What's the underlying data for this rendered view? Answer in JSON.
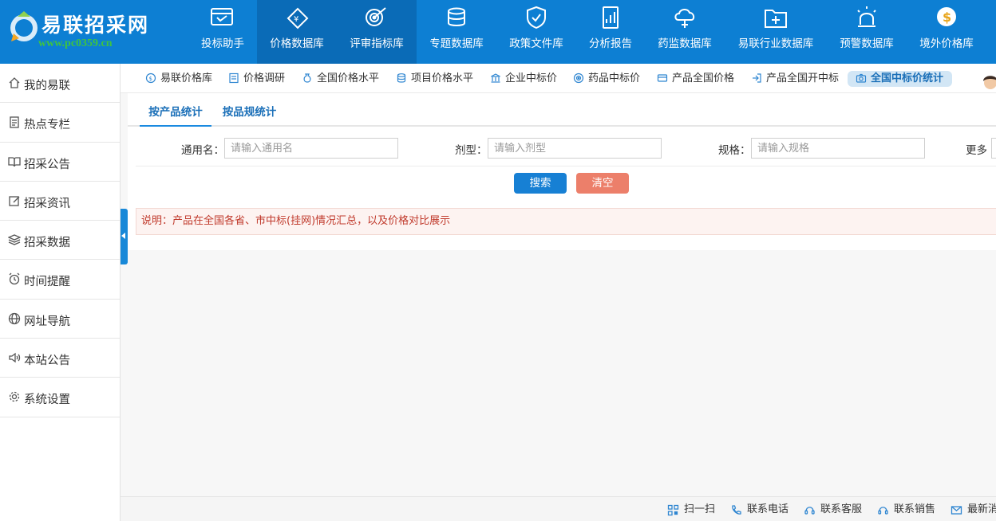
{
  "brand": {
    "name": "易联招采网",
    "url": "www.pc0359.cn"
  },
  "nav": [
    {
      "label": "投标助手",
      "icon": "bid-assistant-icon"
    },
    {
      "label": "价格数据库",
      "icon": "price-database-icon"
    },
    {
      "label": "评审指标库",
      "icon": "review-indicator-icon"
    },
    {
      "label": "专题数据库",
      "icon": "topic-database-icon"
    },
    {
      "label": "政策文件库",
      "icon": "policy-file-icon"
    },
    {
      "label": "分析报告",
      "icon": "analysis-report-icon"
    },
    {
      "label": "药监数据库",
      "icon": "drug-supervision-icon"
    },
    {
      "label": "易联行业数据库",
      "icon": "industry-database-icon"
    },
    {
      "label": "预警数据库",
      "icon": "warning-database-icon"
    },
    {
      "label": "境外价格库",
      "icon": "foreign-price-icon"
    }
  ],
  "sidebar": [
    {
      "label": "我的易联",
      "icon": "home-icon"
    },
    {
      "label": "热点专栏",
      "icon": "document-icon"
    },
    {
      "label": "招采公告",
      "icon": "book-icon"
    },
    {
      "label": "招采资讯",
      "icon": "edit-icon"
    },
    {
      "label": "招采数据",
      "icon": "layers-icon"
    },
    {
      "label": "时间提醒",
      "icon": "alarm-clock-icon"
    },
    {
      "label": "网址导航",
      "icon": "globe-icon"
    },
    {
      "label": "本站公告",
      "icon": "speaker-icon"
    },
    {
      "label": "系统设置",
      "icon": "gear-icon"
    }
  ],
  "subtabs": [
    {
      "label": "易联价格库",
      "icon": "coin-icon"
    },
    {
      "label": "价格调研",
      "icon": "report-icon"
    },
    {
      "label": "全国价格水平",
      "icon": "money-bag-icon"
    },
    {
      "label": "项目价格水平",
      "icon": "database-icon"
    },
    {
      "label": "企业中标价",
      "icon": "bank-icon"
    },
    {
      "label": "药品中标价",
      "icon": "target-icon"
    },
    {
      "label": "产品全国价格",
      "icon": "card-icon"
    },
    {
      "label": "产品全国开中标",
      "icon": "login-icon"
    },
    {
      "label": "全国中标价统计",
      "icon": "camera-icon"
    }
  ],
  "product_tabs": [
    "按产品统计",
    "按品规统计"
  ],
  "form": {
    "generic_name_label": "通用名：",
    "generic_name_placeholder": "请输入通用名",
    "dosage_label": "剂型：",
    "dosage_placeholder": "请输入剂型",
    "spec_label": "规格：",
    "spec_placeholder": "请输入规格",
    "more_label": "更多"
  },
  "buttons": {
    "search": "搜索",
    "clear": "清空"
  },
  "note": "说明：产品在全国各省、市中标(挂网)情况汇总，以及价格对比展示",
  "footer": [
    {
      "label": "扫一扫",
      "icon": "qr-code-icon"
    },
    {
      "label": "联系电话",
      "icon": "phone-icon"
    },
    {
      "label": "联系客服",
      "icon": "customer-service-icon"
    },
    {
      "label": "联系销售",
      "icon": "sales-icon"
    },
    {
      "label": "最新消",
      "icon": "mail-icon"
    }
  ],
  "colors": {
    "primary": "#0d7fd3",
    "nav_active": "#0a6bb7",
    "search_button": "#1780d4",
    "clear_button": "#ec7f6a",
    "note_text": "#c0392b"
  }
}
